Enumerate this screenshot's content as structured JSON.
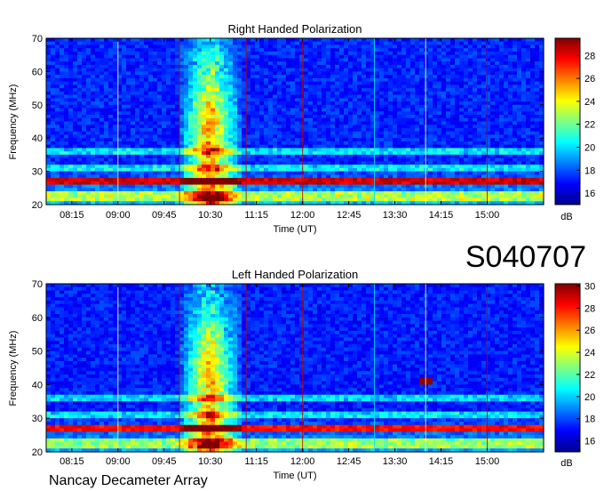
{
  "chart_data": [
    {
      "type": "heatmap",
      "title": "Right Handed Polarization",
      "xlabel": "Time (UT)",
      "ylabel": "Frequency (MHz)",
      "x_ticks": [
        "08:15",
        "09:00",
        "09:45",
        "10:30",
        "11:15",
        "12:00",
        "12:45",
        "13:30",
        "14:15",
        "15:00"
      ],
      "y_ticks": [
        20,
        30,
        40,
        50,
        60,
        70
      ],
      "ylim": [
        20,
        70
      ],
      "colorbar": {
        "label": "dB",
        "ticks": [
          16,
          18,
          20,
          22,
          24,
          26,
          28
        ],
        "range": [
          15,
          29.5
        ]
      },
      "features": {
        "burst_time_range": [
          "09:55",
          "11:00"
        ],
        "burst_peak": "10:30",
        "strong_band_mhz": 27
      }
    },
    {
      "type": "heatmap",
      "title": "Left Handed Polarization",
      "xlabel": "Time (UT)",
      "ylabel": "Frequency (MHz)",
      "x_ticks": [
        "08:15",
        "09:00",
        "09:45",
        "10:30",
        "11:15",
        "12:00",
        "12:45",
        "13:30",
        "14:15",
        "15:00"
      ],
      "y_ticks": [
        20,
        30,
        40,
        50,
        60,
        70
      ],
      "ylim": [
        20,
        70
      ],
      "colorbar": {
        "label": "dB",
        "ticks": [
          16,
          18,
          20,
          22,
          24,
          26,
          28,
          30
        ],
        "range": [
          15,
          30.2
        ]
      },
      "features": {
        "burst_time_range": [
          "09:55",
          "11:00"
        ],
        "burst_peak": "10:30",
        "strong_band_mhz": 27,
        "spot": {
          "time": "14:00",
          "freq_mhz": 41
        }
      }
    }
  ],
  "labels": {
    "date_code": "S040707",
    "instrument": "Nancay Decameter Array"
  },
  "colors": {
    "jet_low": "#00008f",
    "jet_high": "#800000",
    "vertical_line_red": "#c00000",
    "vertical_line_yellow": "#ffff80"
  }
}
